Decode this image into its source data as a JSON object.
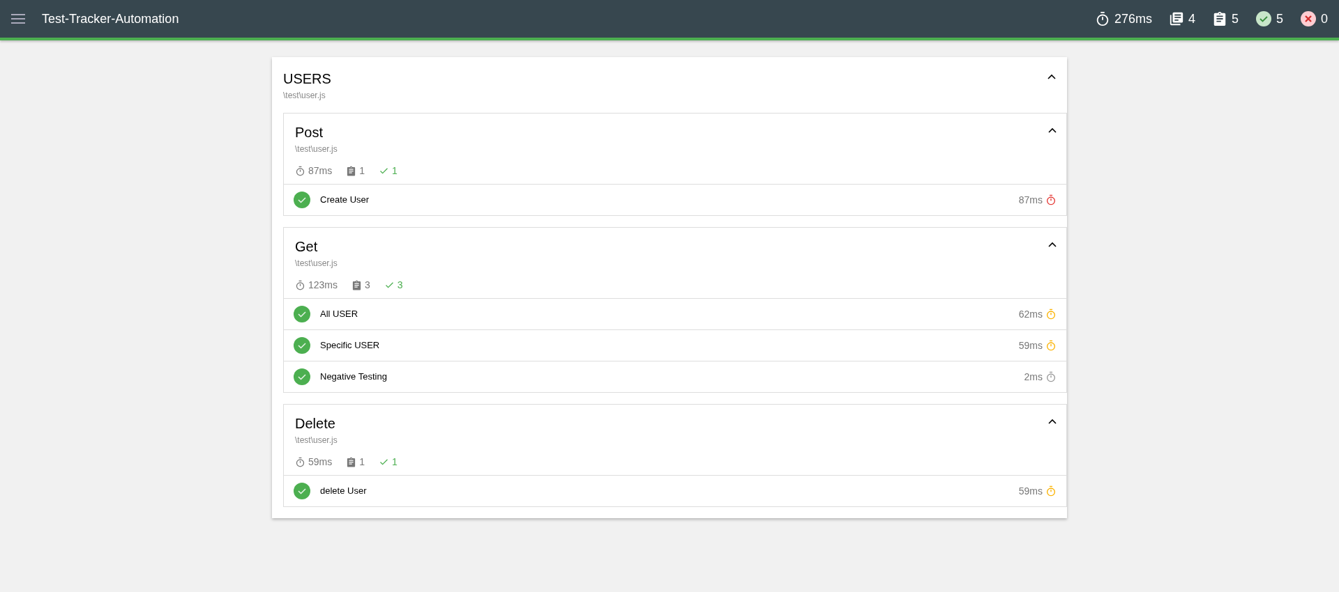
{
  "navbar": {
    "title": "Test-Tracker-Automation",
    "stats": [
      {
        "kind": "duration",
        "value": "276ms"
      },
      {
        "kind": "suites",
        "value": "4"
      },
      {
        "kind": "tests",
        "value": "5"
      },
      {
        "kind": "passes",
        "value": "5"
      },
      {
        "kind": "failures",
        "value": "0"
      }
    ]
  },
  "root_suite": {
    "title": "USERS",
    "file": "\\test\\user.js",
    "expanded": true,
    "suites": [
      {
        "title": "Post",
        "file": "\\test\\user.js",
        "expanded": true,
        "duration": "87ms",
        "tests_count": "1",
        "passed_count": "1",
        "tests": [
          {
            "title": "Create User",
            "kind": "passed",
            "duration": "87ms",
            "color": "#e53935"
          }
        ]
      },
      {
        "title": "Get",
        "file": "\\test\\user.js",
        "expanded": true,
        "duration": "123ms",
        "tests_count": "3",
        "passed_count": "3",
        "tests": [
          {
            "title": "All USER",
            "kind": "passed",
            "duration": "62ms",
            "color": "#fbb200"
          },
          {
            "title": "Specific USER",
            "kind": "passed",
            "duration": "59ms",
            "color": "#fbb200"
          },
          {
            "title": "Negative Testing",
            "kind": "passed",
            "duration": "2ms",
            "color": "#999999"
          }
        ]
      },
      {
        "title": "Delete",
        "file": "\\test\\user.js",
        "expanded": true,
        "duration": "59ms",
        "tests_count": "1",
        "passed_count": "1",
        "tests": [
          {
            "title": "delete User",
            "kind": "passed",
            "duration": "59ms",
            "color": "#fbb200"
          }
        ]
      }
    ]
  }
}
